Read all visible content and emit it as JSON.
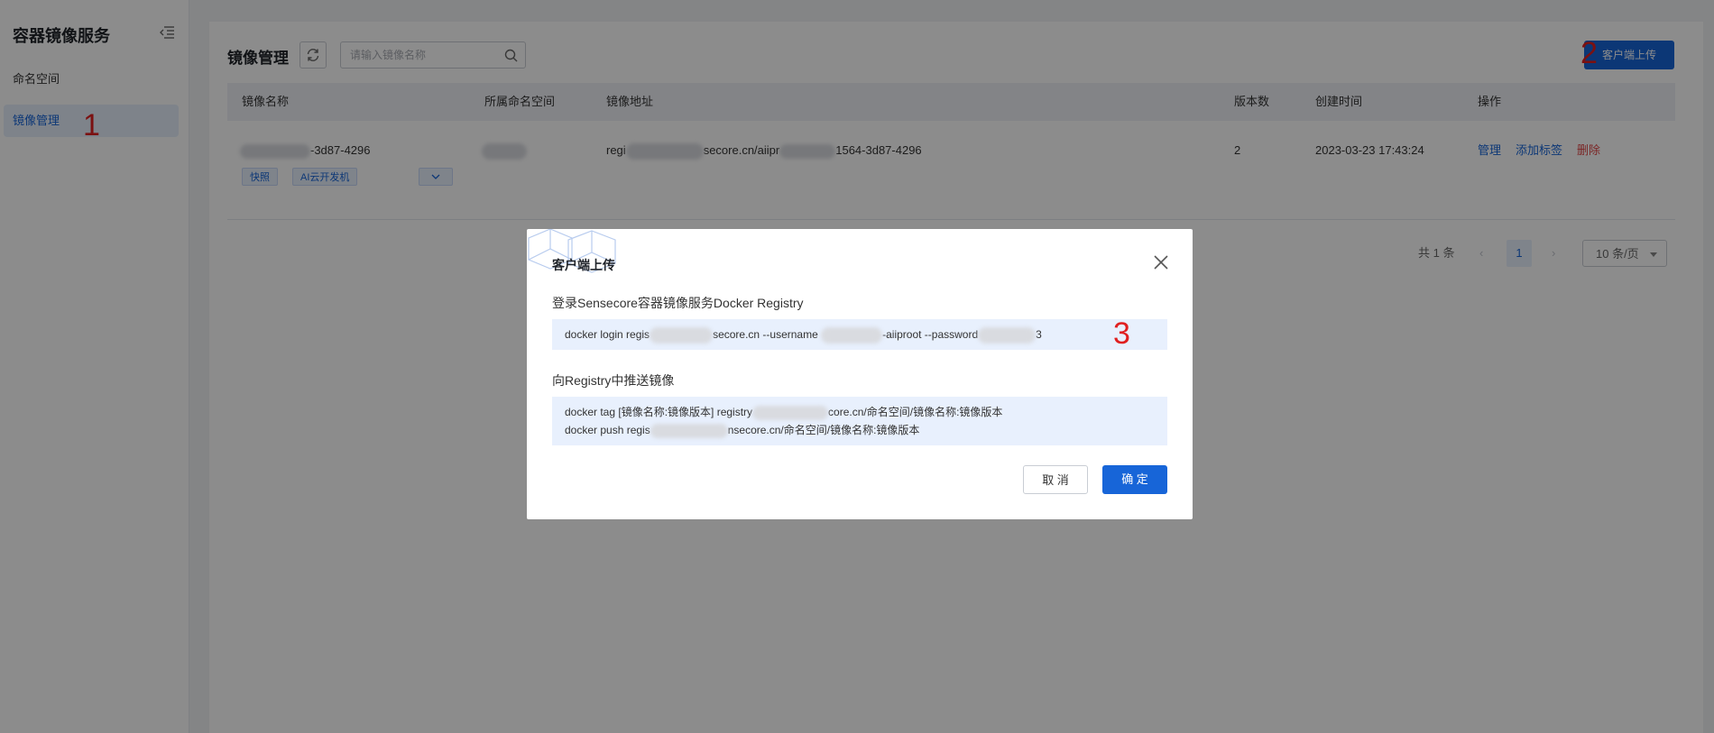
{
  "sidebar": {
    "title": "容器镜像服务",
    "items": [
      {
        "label": "命名空间"
      },
      {
        "label": "镜像管理"
      }
    ]
  },
  "annotations": [
    "1",
    "2",
    "3"
  ],
  "header": {
    "title": "镜像管理",
    "search_placeholder": "请输入镜像名称",
    "upload_button": "客户端上传"
  },
  "table": {
    "columns": [
      "镜像名称",
      "所属命名空间",
      "镜像地址",
      "版本数",
      "创建时间",
      "操作"
    ],
    "rows": [
      {
        "name": "-3d87-4296",
        "namespace": "",
        "address_prefix": "regi",
        "address_mid": "secore.cn/aiipr",
        "address_suffix": "1564-3d87-4296",
        "versions": "2",
        "created": "2023-03-23 17:43:24",
        "tags": [
          "快照",
          "AI云开发机"
        ],
        "actions": {
          "manage": "管理",
          "add_tag": "添加标签",
          "delete": "删除"
        }
      }
    ]
  },
  "pagination": {
    "total": "共 1 条",
    "prev": "‹",
    "page": "1",
    "next": "›",
    "page_size": "10 条/页"
  },
  "modal": {
    "title": "客户端上传",
    "login_label": "登录Sensecore容器镜像服务Docker Registry",
    "login_cmd": {
      "p1": "docker login regis",
      "p2": "secore.cn --username ",
      "p3": "-aiiproot --password",
      "p4": "3"
    },
    "push_label": "向Registry中推送镜像",
    "tag_cmd": {
      "p1": "docker tag [镜像名称:镜像版本] registry",
      "p2": "core.cn/命名空间/镜像名称:镜像版本"
    },
    "push_cmd": {
      "p1": "docker push regis",
      "p2": "nsecore.cn/命名空间/镜像名称:镜像版本"
    },
    "cancel": "取 消",
    "confirm": "确 定"
  },
  "colors": {
    "primary": "#1765d8",
    "danger": "#e04848",
    "annotation": "#e02020"
  }
}
